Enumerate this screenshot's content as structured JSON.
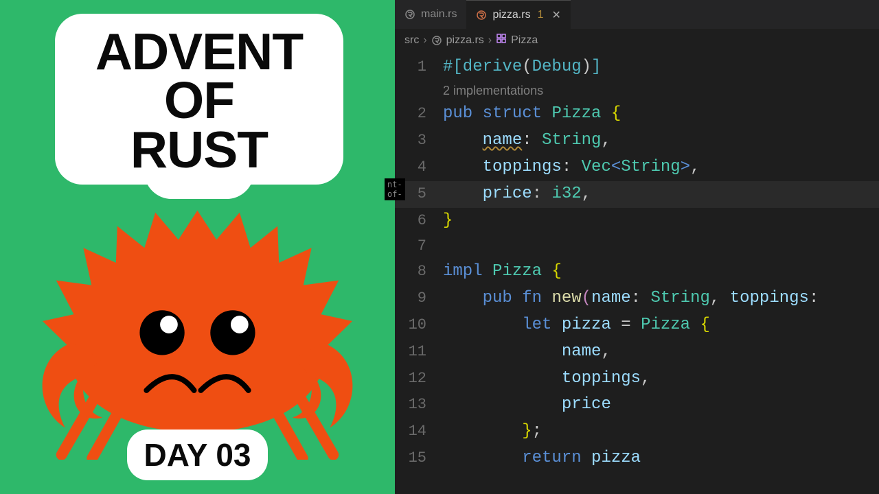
{
  "left": {
    "title_line1": "ADVENT OF",
    "title_line2": "RUST",
    "day_label": "DAY 03",
    "snippet": "nt-of-"
  },
  "editor": {
    "tabs": [
      {
        "label": "main.rs",
        "active": false
      },
      {
        "label": "pizza.rs",
        "active": true,
        "modified": "1"
      }
    ],
    "breadcrumbs": {
      "root": "src",
      "file": "pizza.rs",
      "symbol": "Pizza"
    },
    "codelens": "2 implementations",
    "lines": [
      {
        "n": "1",
        "tokens": [
          [
            "t-attr",
            "#[derive"
          ],
          [
            "t-punct",
            "("
          ],
          [
            "t-attr",
            "Debug"
          ],
          [
            "t-punct",
            ")"
          ],
          [
            "t-attr",
            "]"
          ]
        ]
      },
      {
        "n": "2",
        "tokens": [
          [
            "t-kw",
            "pub "
          ],
          [
            "t-kw",
            "struct "
          ],
          [
            "t-type",
            "Pizza "
          ],
          [
            "t-brace",
            "{"
          ]
        ]
      },
      {
        "n": "3",
        "tokens": [
          [
            "t-punct",
            "    "
          ],
          [
            "t-field warn-underline",
            "name"
          ],
          [
            "t-punct",
            ": "
          ],
          [
            "t-type",
            "String"
          ],
          [
            "t-punct",
            ","
          ]
        ]
      },
      {
        "n": "4",
        "tokens": [
          [
            "t-punct",
            "    "
          ],
          [
            "t-field",
            "toppings"
          ],
          [
            "t-punct",
            ": "
          ],
          [
            "t-type",
            "Vec"
          ],
          [
            "t-angle",
            "<"
          ],
          [
            "t-type",
            "String"
          ],
          [
            "t-angle",
            ">"
          ],
          [
            "t-punct",
            ","
          ]
        ]
      },
      {
        "n": "5",
        "hl": true,
        "tokens": [
          [
            "t-punct",
            "    "
          ],
          [
            "t-field",
            "price"
          ],
          [
            "t-punct",
            ": "
          ],
          [
            "t-type",
            "i32"
          ],
          [
            "t-punct",
            ","
          ]
        ]
      },
      {
        "n": "6",
        "tokens": [
          [
            "t-brace",
            "}"
          ]
        ]
      },
      {
        "n": "7",
        "tokens": []
      },
      {
        "n": "8",
        "tokens": [
          [
            "t-kw",
            "impl "
          ],
          [
            "t-type",
            "Pizza "
          ],
          [
            "t-brace",
            "{"
          ]
        ]
      },
      {
        "n": "9",
        "tokens": [
          [
            "t-punct",
            "    "
          ],
          [
            "t-kw",
            "pub "
          ],
          [
            "t-kw",
            "fn "
          ],
          [
            "t-fn",
            "new"
          ],
          [
            "t-brace2",
            "("
          ],
          [
            "t-field",
            "name"
          ],
          [
            "t-punct",
            ": "
          ],
          [
            "t-type",
            "String"
          ],
          [
            "t-punct",
            ", "
          ],
          [
            "t-field",
            "toppings"
          ],
          [
            "t-punct",
            ":"
          ]
        ]
      },
      {
        "n": "10",
        "tokens": [
          [
            "t-punct",
            "        "
          ],
          [
            "t-kw",
            "let "
          ],
          [
            "t-field",
            "pizza"
          ],
          [
            "t-punct",
            " = "
          ],
          [
            "t-type",
            "Pizza "
          ],
          [
            "t-brace",
            "{"
          ]
        ]
      },
      {
        "n": "11",
        "tokens": [
          [
            "t-punct",
            "            "
          ],
          [
            "t-field",
            "name"
          ],
          [
            "t-punct",
            ","
          ]
        ]
      },
      {
        "n": "12",
        "tokens": [
          [
            "t-punct",
            "            "
          ],
          [
            "t-field",
            "toppings"
          ],
          [
            "t-punct",
            ","
          ]
        ]
      },
      {
        "n": "13",
        "tokens": [
          [
            "t-punct",
            "            "
          ],
          [
            "t-field",
            "price"
          ]
        ]
      },
      {
        "n": "14",
        "tokens": [
          [
            "t-punct",
            "        "
          ],
          [
            "t-brace",
            "}"
          ],
          [
            "t-punct",
            ";"
          ]
        ]
      },
      {
        "n": "15",
        "tokens": [
          [
            "t-punct",
            "        "
          ],
          [
            "t-kw",
            "return "
          ],
          [
            "t-field",
            "pizza"
          ]
        ]
      }
    ]
  }
}
